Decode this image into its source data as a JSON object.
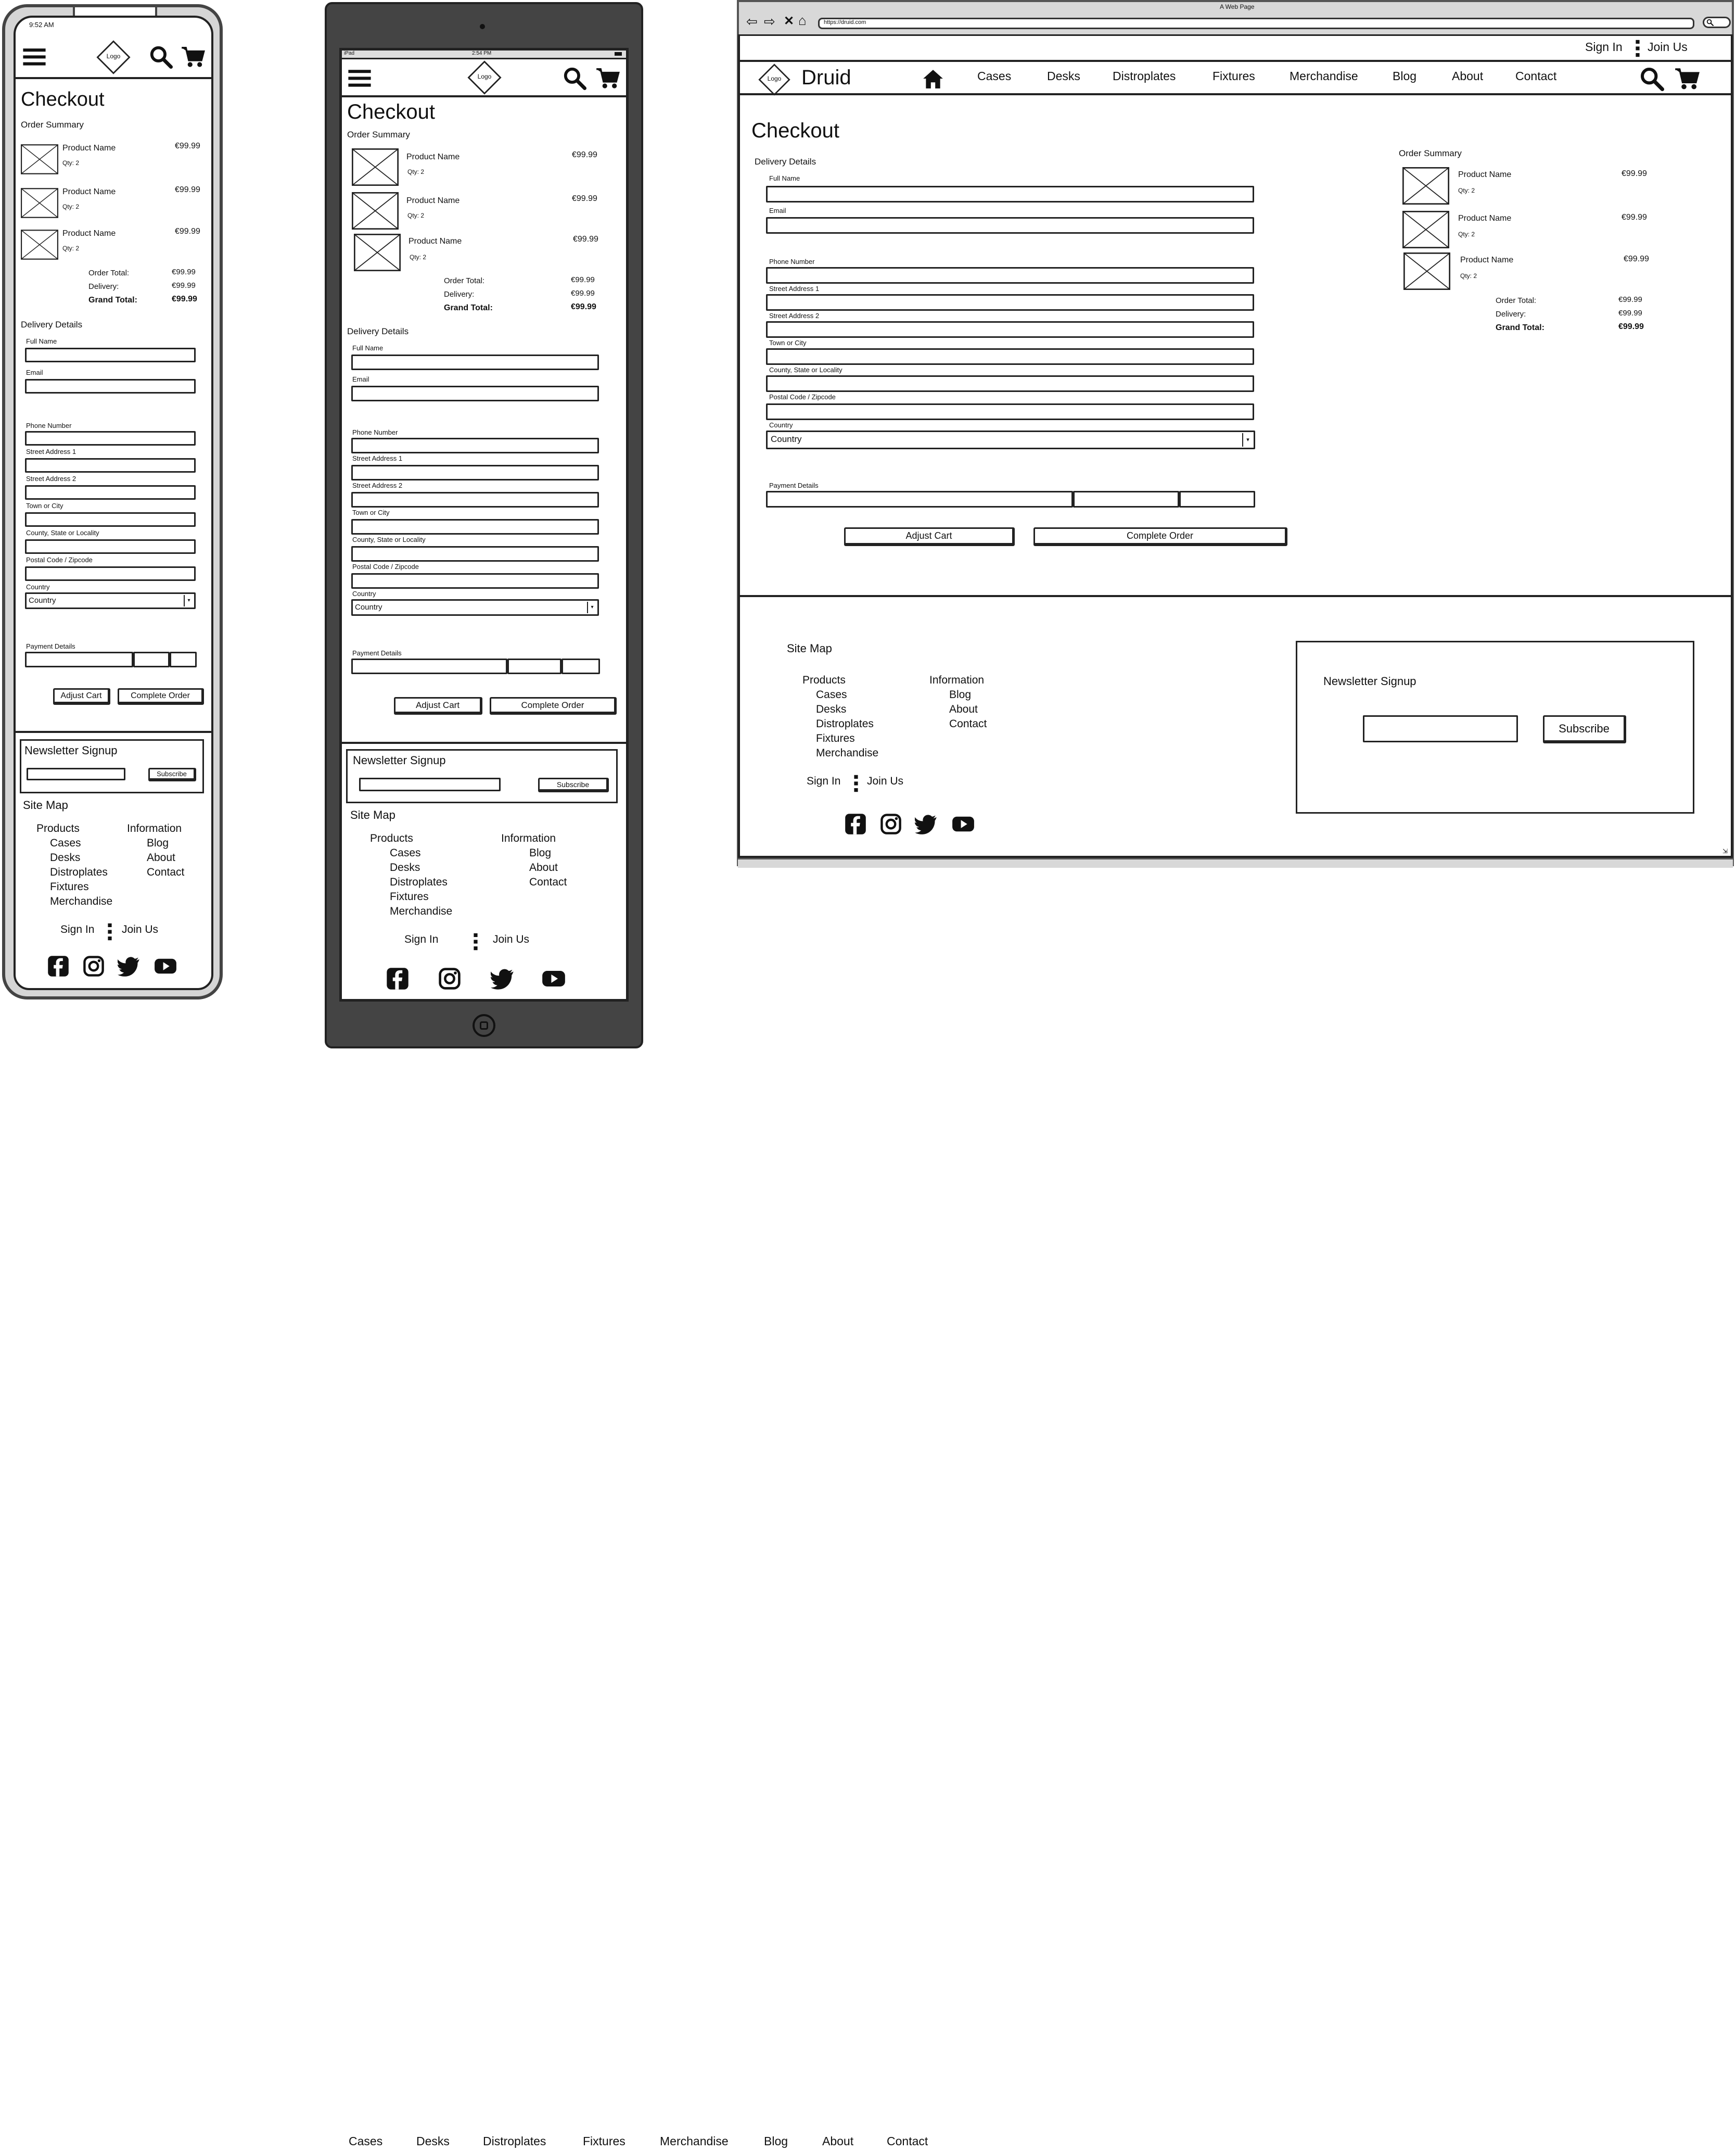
{
  "common": {
    "logo_text": "Logo",
    "checkout_title": "Checkout",
    "order_summary": "Order Summary",
    "delivery_details": "Delivery Details",
    "product_name": "Product Name",
    "price": "€99.99",
    "qty": "Qty: 2",
    "order_total_label": "Order Total:",
    "delivery_label": "Delivery:",
    "grand_total_label": "Grand Total:",
    "order_total_value": "€99.99",
    "delivery_value": "€99.99",
    "grand_total_value": "€99.99",
    "fields": {
      "full_name": "Full Name",
      "email": "Email",
      "phone": "Phone Number",
      "street1": "Street Address 1",
      "street2": "Street Address 2",
      "town": "Town or City",
      "county": "County, State or Locality",
      "postal": "Postal Code / Zipcode",
      "country": "Country",
      "payment": "Payment Details"
    },
    "country_value": "Country",
    "adjust_cart": "Adjust Cart",
    "complete_order": "Complete Order",
    "newsletter": "Newsletter Signup",
    "subscribe": "Subscribe",
    "site_map": "Site Map",
    "products": "Products",
    "information": "Information",
    "product_links": [
      "Cases",
      "Desks",
      "Distroplates",
      "Fixtures",
      "Merchandise"
    ],
    "info_links": [
      "Blog",
      "About",
      "Contact"
    ],
    "sign_in": "Sign In",
    "join_us": "Join Us"
  },
  "phone": {
    "time": "9:52 AM"
  },
  "tablet": {
    "status_left": "iPad",
    "time": "2:54 PM"
  },
  "desktop": {
    "window_title": "A Web Page",
    "url": "https://druid.com",
    "brand": "Druid",
    "nav": [
      "Cases",
      "Desks",
      "Distroplates",
      "Fixtures",
      "Merchandise",
      "Blog",
      "About",
      "Contact"
    ]
  },
  "stray_nav": [
    "Cases",
    "Desks",
    "Distroplates",
    "Fixtures",
    "Merchandise",
    "Blog",
    "About",
    "Contact"
  ],
  "icons": [
    "hamburger-icon",
    "search-icon",
    "cart-icon",
    "home-icon",
    "facebook-icon",
    "instagram-icon",
    "twitter-icon",
    "youtube-icon",
    "image-placeholder-icon",
    "back-icon",
    "forward-icon",
    "close-icon",
    "home-browser-icon",
    "search-toggle-icon"
  ]
}
